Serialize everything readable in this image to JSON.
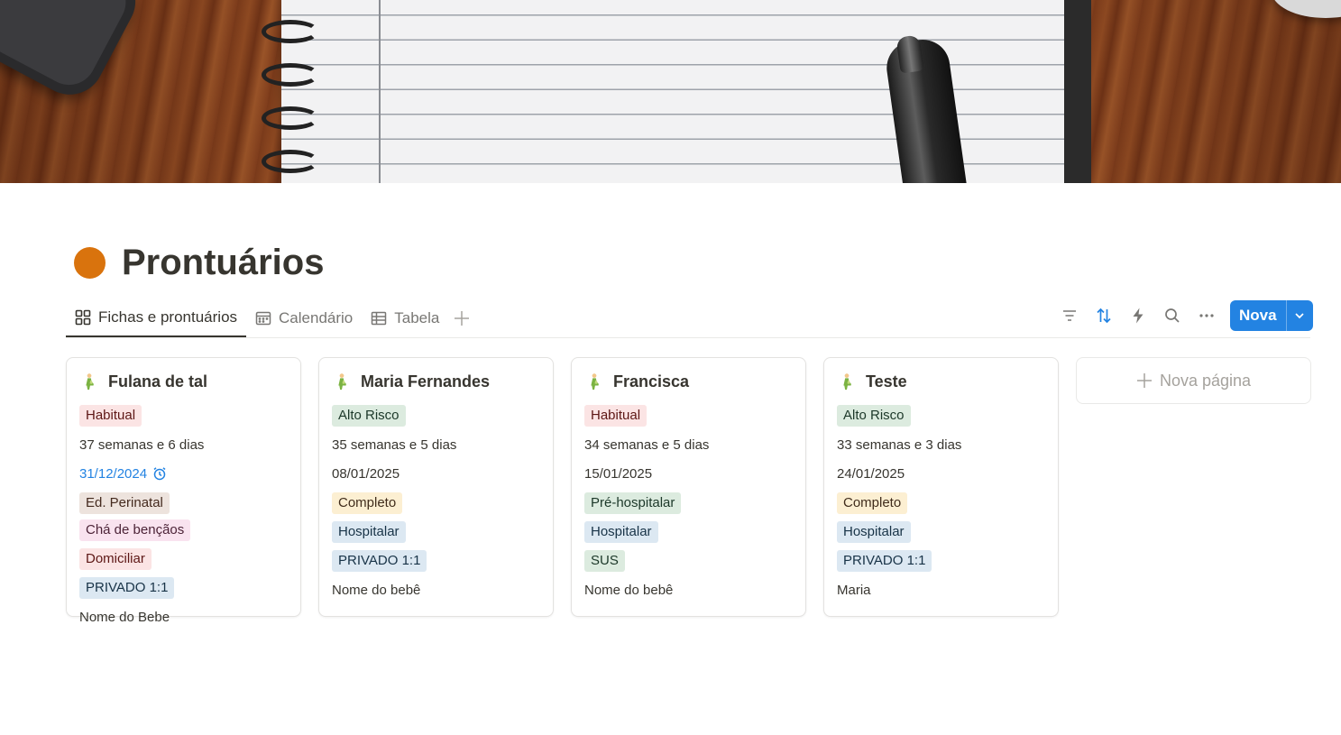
{
  "page": {
    "title": "Prontuários",
    "icon": "orange-circle-icon",
    "icon_color": "#d9730d",
    "accent_color": "#2383e2"
  },
  "views": [
    {
      "label": "Fichas e prontuários",
      "icon": "gallery-grid-icon",
      "active": true
    },
    {
      "label": "Calendário",
      "icon": "calendar-icon",
      "active": false
    },
    {
      "label": "Tabela",
      "icon": "table-icon",
      "active": false
    }
  ],
  "toolbar": {
    "icons": [
      "filter-icon",
      "sort-icon",
      "lightning-icon",
      "search-icon",
      "more-icon"
    ],
    "new_label": "Nova",
    "new_dropdown_icon": "chevron-down-icon"
  },
  "cards": [
    {
      "title": "Fulana de tal",
      "icon": "pregnant-person-icon",
      "risk": {
        "label": "Habitual",
        "bg": "#fbe4e4",
        "fg": "#5d1715"
      },
      "weeks": "37 semanas e 6 dias",
      "date": "31/12/2024",
      "date_reminder": true,
      "services": [
        {
          "label": "Ed. Perinatal",
          "bg": "#ede3dd",
          "fg": "#442a1e"
        },
        {
          "label": "Chá de bençãos",
          "bg": "#f9e3ef",
          "fg": "#4c2337"
        }
      ],
      "place": {
        "label": "Domiciliar",
        "bg": "#fbe4e4",
        "fg": "#5d1715"
      },
      "plan": {
        "label": "PRIVADO 1:1",
        "bg": "#dce8f2",
        "fg": "#183347"
      },
      "baby": "Nome do Bebe"
    },
    {
      "title": "Maria Fernandes",
      "icon": "pregnant-person-icon",
      "risk": {
        "label": "Alto Risco",
        "bg": "#dcebdf",
        "fg": "#1c3829"
      },
      "weeks": "35 semanas e 5 dias",
      "date": "08/01/2025",
      "date_reminder": false,
      "services": [
        {
          "label": "Completo",
          "bg": "#fcefd2",
          "fg": "#402c1b"
        }
      ],
      "place": {
        "label": "Hospitalar",
        "bg": "#dce8f2",
        "fg": "#183347"
      },
      "plan": {
        "label": "PRIVADO 1:1",
        "bg": "#dce8f2",
        "fg": "#183347"
      },
      "baby": "Nome do bebê"
    },
    {
      "title": "Francisca",
      "icon": "pregnant-person-icon",
      "risk": {
        "label": "Habitual",
        "bg": "#fbe4e4",
        "fg": "#5d1715"
      },
      "weeks": "34 semanas e 5 dias",
      "date": "15/01/2025",
      "date_reminder": false,
      "services": [
        {
          "label": "Pré-hospitalar",
          "bg": "#dcebdf",
          "fg": "#1c3829"
        }
      ],
      "place": {
        "label": "Hospitalar",
        "bg": "#dce8f2",
        "fg": "#183347"
      },
      "plan": {
        "label": "SUS",
        "bg": "#dcebdf",
        "fg": "#1c3829"
      },
      "baby": "Nome do bebê"
    },
    {
      "title": "Teste",
      "icon": "pregnant-person-icon",
      "risk": {
        "label": "Alto Risco",
        "bg": "#dcebdf",
        "fg": "#1c3829"
      },
      "weeks": "33 semanas e 3 dias",
      "date": "24/01/2025",
      "date_reminder": false,
      "services": [
        {
          "label": "Completo",
          "bg": "#fcefd2",
          "fg": "#402c1b"
        }
      ],
      "place": {
        "label": "Hospitalar",
        "bg": "#dce8f2",
        "fg": "#183347"
      },
      "plan": {
        "label": "PRIVADO 1:1",
        "bg": "#dce8f2",
        "fg": "#183347"
      },
      "baby": "Maria"
    }
  ],
  "new_page": {
    "label": "Nova página",
    "icon": "plus-icon"
  }
}
